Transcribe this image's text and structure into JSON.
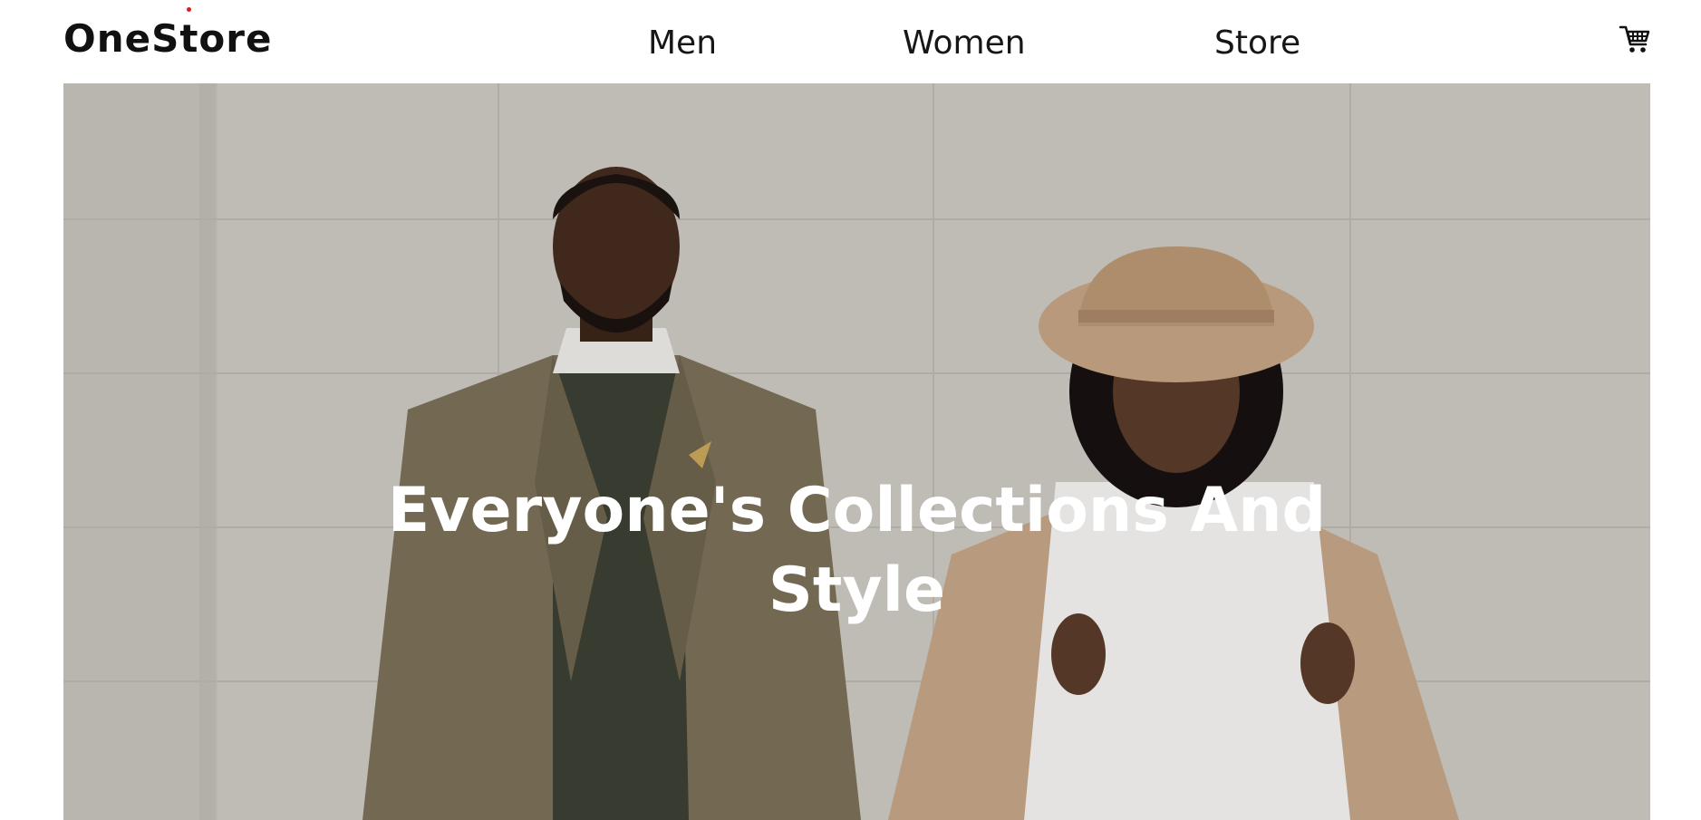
{
  "brand": {
    "logo_text": "OneStore",
    "accent_color": "#d81f26"
  },
  "nav": {
    "items": [
      {
        "label": "Men"
      },
      {
        "label": "Women"
      },
      {
        "label": "Store"
      }
    ]
  },
  "cart": {
    "icon": "cart-icon"
  },
  "hero": {
    "title_line1": "Everyone's Collections And",
    "title_line2": "Style",
    "image_description_icon": "hero-photo"
  }
}
